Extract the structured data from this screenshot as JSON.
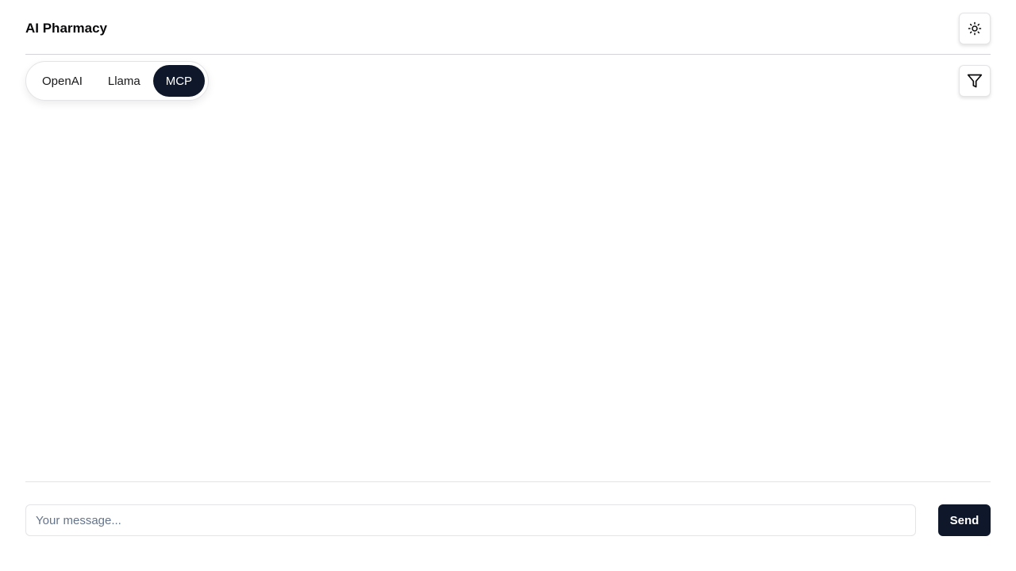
{
  "header": {
    "title": "AI Pharmacy",
    "theme_toggle_icon": "sun-icon"
  },
  "tabs": [
    {
      "label": "OpenAI",
      "active": false
    },
    {
      "label": "Llama",
      "active": false
    },
    {
      "label": "MCP",
      "active": true
    }
  ],
  "toolbar": {
    "filter_icon": "filter-icon"
  },
  "composer": {
    "placeholder": "Your message...",
    "value": "",
    "send_label": "Send"
  },
  "colors": {
    "primary": "#0f172a",
    "border": "#e4e4e7",
    "placeholder": "#64748b"
  }
}
